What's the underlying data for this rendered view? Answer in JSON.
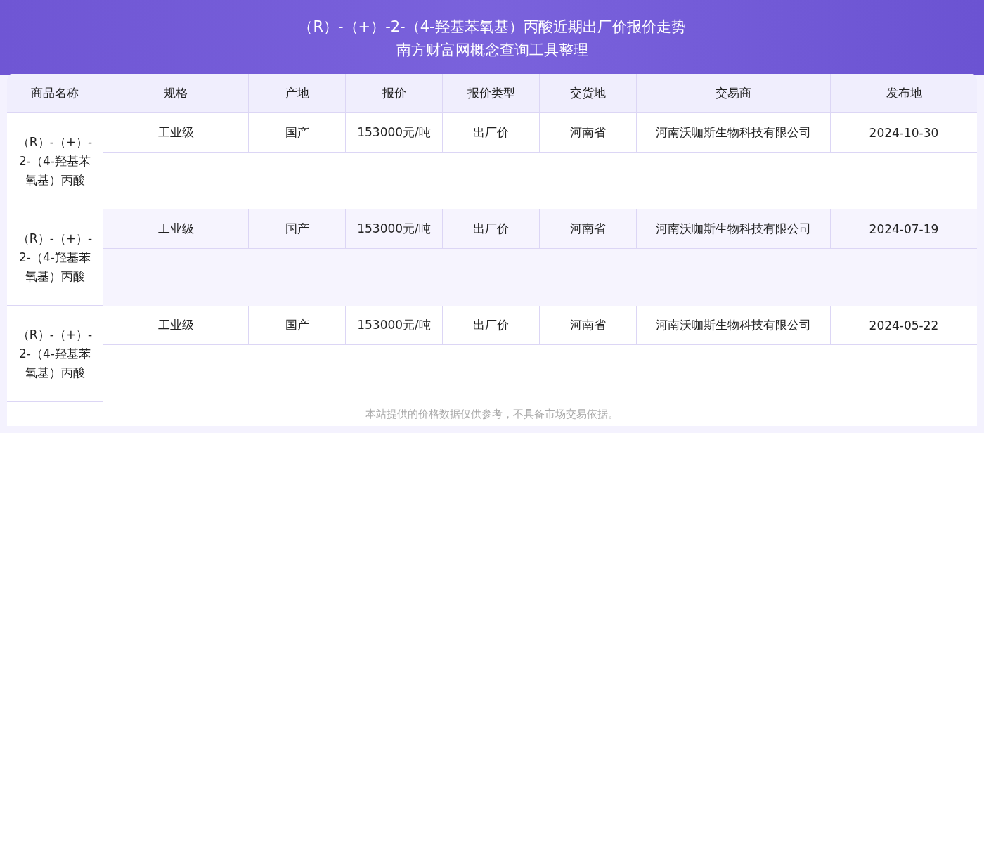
{
  "header": {
    "title": "（R）-（+）-2-（4-羟基苯氧基）丙酸近期出厂价报价走势",
    "subtitle": "南方财富网概念查询工具整理"
  },
  "table": {
    "columns": [
      "商品名称",
      "规格",
      "产地",
      "报价",
      "报价类型",
      "交货地",
      "交易商",
      "发布地"
    ],
    "rows": [
      {
        "cells": [
          "（R）-（+）-2-（4-羟基苯氧基）丙酸",
          "工业级",
          "国产",
          "153000元/吨",
          "出厂价",
          "河南省",
          "河南沃咖斯生物科技有限公司",
          "2024-10-30"
        ]
      },
      {
        "cells": [
          "（R）-（+）-2-（4-羟基苯氧基）丙酸",
          "工业级",
          "国产",
          "153000元/吨",
          "出厂价",
          "河南省",
          "河南沃咖斯生物科技有限公司",
          "2024-07-19"
        ]
      },
      {
        "cells": [
          "（R）-（+）-2-（4-羟基苯氧基）丙酸",
          "工业级",
          "国产",
          "153000元/吨",
          "出厂价",
          "河南省",
          "河南沃咖斯生物科技有限公司",
          "2024-05-22"
        ]
      }
    ]
  },
  "footer": {
    "note": "本站提供的价格数据仅供参考，不具备市场交易依据。"
  }
}
